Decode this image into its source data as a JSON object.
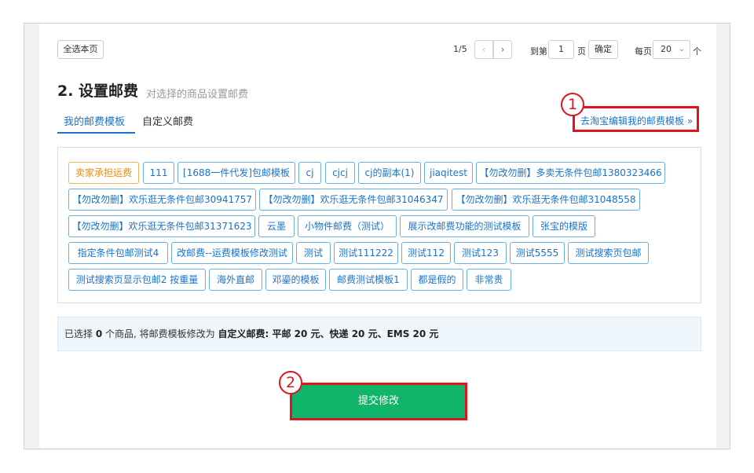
{
  "toolbar": {
    "select_all": "全选本页"
  },
  "pager": {
    "count": "1/5",
    "prev_icon": "‹",
    "next_icon": "›",
    "goto_label": "到第",
    "goto_value": "1",
    "page_label": "页",
    "confirm": "确定",
    "per_page_label": "每页",
    "per_page_value": "20",
    "unit": "个"
  },
  "section": {
    "title": "2. 设置邮费",
    "subtitle": "对选择的商品设置邮费",
    "tabs": [
      "我的邮费模板",
      "自定义邮费"
    ],
    "edit_link": "去淘宝编辑我的邮费模板 »"
  },
  "callouts": {
    "one": "1",
    "two": "2"
  },
  "templates": [
    "卖家承担运费",
    "111",
    "[1688一件代发]包邮模板",
    "cj",
    "cjcj",
    "cj的副本(1)",
    "jiaqitest",
    "【勿改勿删】多卖无条件包邮1380323466",
    "【勿改勿删】欢乐逛无条件包邮30941757",
    "【勿改勿删】欢乐逛无条件包邮31046347",
    "【勿改勿删】欢乐逛无条件包邮31048558",
    "【勿改勿删】欢乐逛无条件包邮31371623",
    "云墨",
    "小物件邮费（测试）",
    "展示改邮费功能的测试模板",
    "张宝的模版",
    "指定条件包邮测试4",
    "改邮费--运费模板修改测试",
    "测试",
    "测试111222",
    "测试112",
    "测试123",
    "测试5555",
    "测试搜索页包邮",
    "测试搜索页显示包邮2 按重量",
    "海外直邮",
    "邓鎏的模板",
    "邮费测试模板1",
    "都是假的",
    "非常贵"
  ],
  "summary": {
    "prefix": "已选择",
    "count": "0",
    "middle": "个商品, 将邮费模板修改为",
    "setting": "自定义邮费: 平邮 20 元、快递 20 元、EMS 20 元"
  },
  "submit": "提交修改"
}
